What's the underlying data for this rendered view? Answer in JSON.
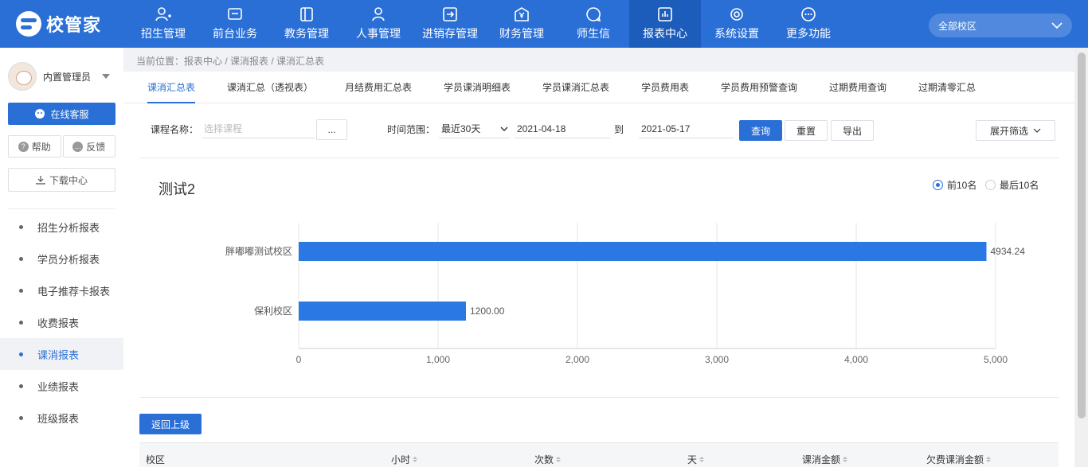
{
  "app": {
    "logo": "校管家"
  },
  "nav": [
    {
      "label": "招生管理",
      "icon": "person-add-icon"
    },
    {
      "label": "前台业务",
      "icon": "monitor-icon"
    },
    {
      "label": "教务管理",
      "icon": "book-icon"
    },
    {
      "label": "人事管理",
      "icon": "user-icon"
    },
    {
      "label": "进销存管理",
      "icon": "import-icon"
    },
    {
      "label": "财务管理",
      "icon": "yen-icon"
    },
    {
      "label": "师生信",
      "icon": "chat-icon"
    },
    {
      "label": "报表中心",
      "icon": "chart-icon"
    },
    {
      "label": "系统设置",
      "icon": "gear-icon"
    },
    {
      "label": "更多功能",
      "icon": "more-icon"
    }
  ],
  "campus": {
    "label": "全部校区"
  },
  "user": {
    "name": "内置管理员"
  },
  "sidebar": {
    "service": "在线客服",
    "help": "帮助",
    "feedback": "反馈",
    "download": "下载中心",
    "menu": [
      {
        "label": "招生分析报表"
      },
      {
        "label": "学员分析报表"
      },
      {
        "label": "电子推荐卡报表"
      },
      {
        "label": "收费报表"
      },
      {
        "label": "课消报表"
      },
      {
        "label": "业绩报表"
      },
      {
        "label": "班级报表"
      }
    ]
  },
  "breadcrumb": "当前位置：报表中心 / 课消报表 / 课消汇总表",
  "tabs": [
    {
      "label": "课消汇总表"
    },
    {
      "label": "课消汇总（透视表）"
    },
    {
      "label": "月结费用汇总表"
    },
    {
      "label": "学员课消明细表"
    },
    {
      "label": "学员课消汇总表"
    },
    {
      "label": "学员费用表"
    },
    {
      "label": "学员费用预警查询"
    },
    {
      "label": "过期费用查询"
    },
    {
      "label": "过期清零汇总"
    }
  ],
  "filters": {
    "course_label": "课程名称：",
    "course_placeholder": "选择课程",
    "browse": "...",
    "range_label": "时间范围：",
    "range_value": "最近30天",
    "date_from": "2021-04-18",
    "to": "到",
    "date_to": "2021-05-17",
    "query": "查询",
    "reset": "重置",
    "export": "导出",
    "expand": "展开筛选"
  },
  "chart_title": "测试2",
  "rank": {
    "top": "前10名",
    "bottom": "最后10名"
  },
  "chart_data": {
    "type": "bar",
    "orientation": "horizontal",
    "categories": [
      "胖嘟嘟测试校区",
      "保利校区"
    ],
    "values": [
      4934.24,
      1200.0
    ],
    "value_labels": [
      "4934.24",
      "1200.00"
    ],
    "xlim": [
      0,
      5000
    ],
    "xticks": [
      "0",
      "1,000",
      "2,000",
      "3,000",
      "4,000",
      "5,000"
    ],
    "grid": true,
    "color": "#2a78e4"
  },
  "back": "返回上级",
  "table": {
    "columns": [
      "校区",
      "小时",
      "次数",
      "天",
      "课消金额",
      "欠费课消金额"
    ]
  }
}
